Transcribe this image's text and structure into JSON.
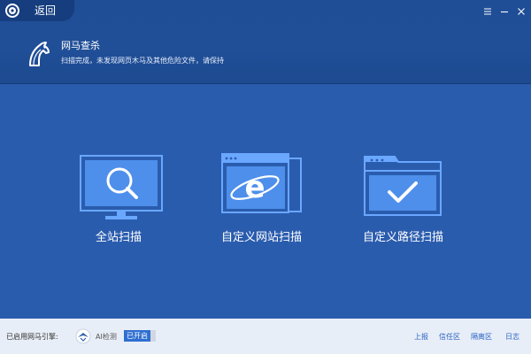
{
  "titlebar": {
    "back_label": "返回"
  },
  "header": {
    "title": "网马查杀",
    "subtitle": "扫描完成，未发现网页木马及其他危险文件，请保持"
  },
  "scan_options": [
    {
      "label": "全站扫描",
      "icon": "monitor-magnifier-icon"
    },
    {
      "label": "自定义网站扫描",
      "icon": "browser-ie-icon"
    },
    {
      "label": "自定义路径扫描",
      "icon": "folder-check-icon"
    }
  ],
  "footer": {
    "engine_label": "已启用网马引擎:",
    "ai_label": "AI检测",
    "ai_status": "已开启",
    "links": [
      "上报",
      "信任区",
      "隔离区",
      "日志"
    ]
  },
  "colors": {
    "header_bg": "#1f4d96",
    "main_bg": "#2a5cae",
    "icon_blue": "#6aa7ff",
    "footer_bg": "#e8eef7",
    "link_blue": "#2b64c4",
    "badge_blue": "#2f6fd0"
  }
}
